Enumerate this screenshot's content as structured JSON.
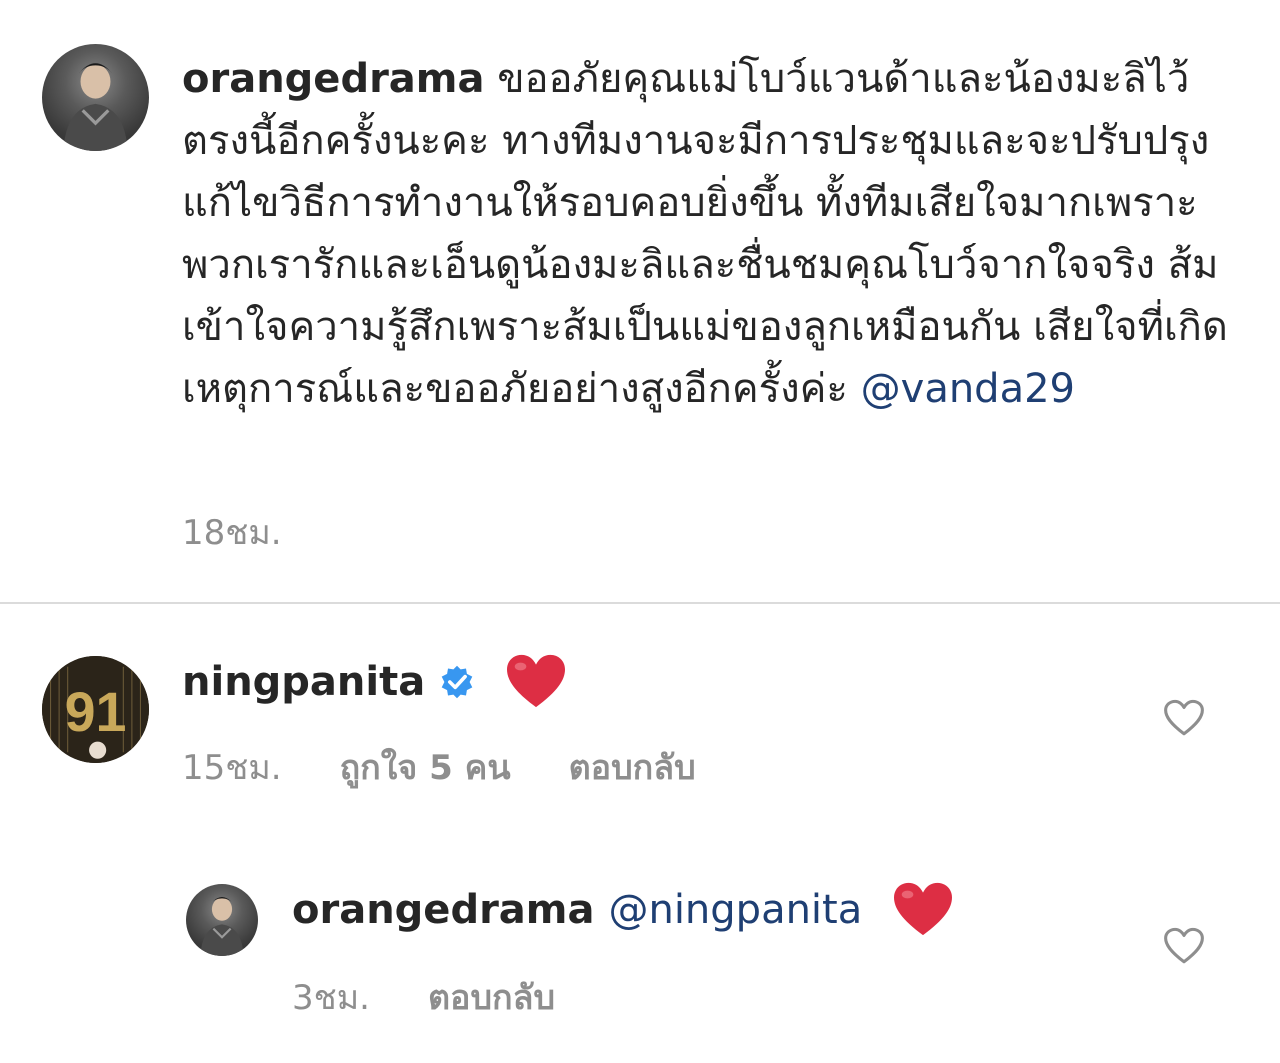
{
  "comment_main": {
    "username": "orangedrama",
    "text": "ขออภัยคุณแม่โบว์แวนด้าและน้องมะลิไว้ตรงนี้อีกครั้งนะคะ ทางทีมงานจะมีการประชุมและจะปรับปรุงแก้ไขวิธีการทำงานให้รอบคอบยิ่งขึ้น ทั้งทีมเสียใจมากเพราะพวกเรารักและเอ็นดูน้องมะลิและชื่นชมคุณโบว์จากใจจริง ส้มเข้าใจความรู้สึกเพราะส้มเป็นแม่ของลูกเหมือนกัน เสียใจที่เกิดเหตุการณ์และขออภัยอย่างสูงอีกครั้งค่ะ",
    "mention": "@vanda29",
    "time": "18ชม."
  },
  "comment_ning": {
    "username": "ningpanita",
    "avatar_text": "91",
    "time": "15ชม.",
    "likes": "ถูกใจ 5 คน",
    "reply_label": "ตอบกลับ"
  },
  "comment_reply": {
    "username": "orangedrama",
    "mention": "@ningpanita",
    "time": "3ชม.",
    "reply_label": "ตอบกลับ"
  },
  "colors": {
    "text": "#262626",
    "meta": "#8e8e8e",
    "mention": "#1f3f73",
    "verified": "#3897f0",
    "heart": "#dd2e44",
    "divider": "#dbdbdb"
  },
  "icons": [
    "verified-badge-icon",
    "red-heart-emoji-icon",
    "heart-outline-icon"
  ]
}
